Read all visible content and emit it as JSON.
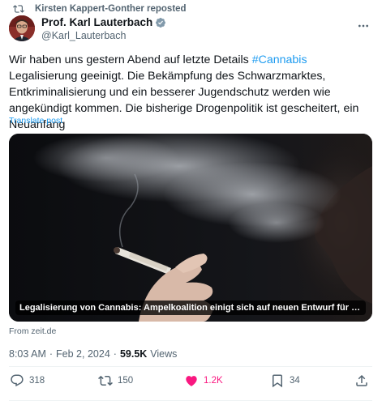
{
  "repost": {
    "icon": "repost-icon",
    "text": "Kirsten Kappert-Gonther reposted"
  },
  "author": {
    "display_name": "Prof. Karl Lauterbach",
    "handle": "@Karl_Lauterbach",
    "verified_icon": "verified-badge-icon",
    "avatar_icon": "avatar"
  },
  "more_icon": "more-icon",
  "tweet": {
    "text_before": "Wir haben uns gestern Abend auf letzte Details ",
    "hashtag": "#Cannabis",
    "text_after": " Legalisierung geeinigt. Die Bekämpfung des Schwarzmarktes, Entkriminalisierung und ein besserer Jugendschutz werden wie angekündigt kommen. Die bisherige Drogenpolitik ist gescheitert, ein Neuanfang",
    "translate_label": "Translate post"
  },
  "media": {
    "caption": "Legalisierung von Cannabis: Ampelkoalition einigt sich auf neuen Entwurf für Cannabisl...",
    "source": "From zeit.de"
  },
  "meta": {
    "time": "8:03 AM",
    "separator": "·",
    "date": "Feb 2, 2024",
    "views_count": "59.5K",
    "views_label": "Views"
  },
  "actions": {
    "replies": {
      "icon": "reply-icon",
      "count": "318"
    },
    "reposts": {
      "icon": "repost-icon",
      "count": "150"
    },
    "likes": {
      "icon": "heart-icon",
      "count": "1.2K",
      "color": "#f91880"
    },
    "bookmarks": {
      "icon": "bookmark-icon",
      "count": "34"
    },
    "share": {
      "icon": "share-icon"
    }
  },
  "colors": {
    "link": "#1d9bf0",
    "secondary_text": "#536471",
    "primary_text": "#0f1419",
    "like": "#f91880"
  }
}
